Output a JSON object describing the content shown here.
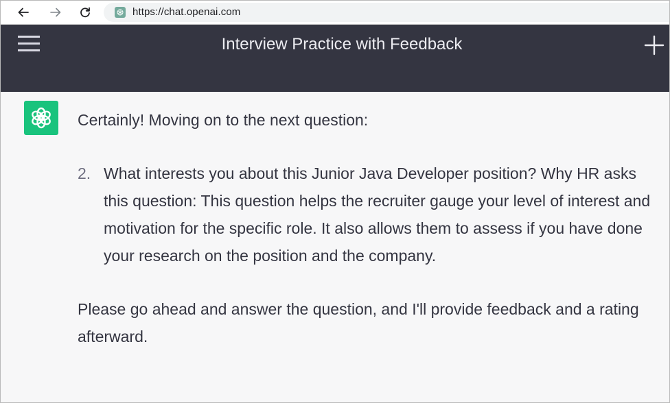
{
  "browser": {
    "url": "https://chat.openai.com",
    "favicon": "openai-favicon-icon"
  },
  "header": {
    "title": "Interview Practice with Feedback",
    "menu_icon": "hamburger-menu-icon",
    "new_chat_icon": "plus-icon"
  },
  "message": {
    "avatar_icon": "openai-logo-icon",
    "intro": "Certainly! Moving on to the next question:",
    "question": {
      "number": "2.",
      "text": "What interests you about this Junior Java Developer position? Why HR asks this question: This question helps the recruiter gauge your level of interest and motivation for the specific role. It also allows them to assess if you have done your research on the position and the company."
    },
    "outro": "Please go ahead and answer the question, and I'll provide feedback and a rating afterward."
  },
  "colors": {
    "header_bg": "#343541",
    "avatar_bg": "#19c37d",
    "message_bg": "#f7f7f8"
  }
}
